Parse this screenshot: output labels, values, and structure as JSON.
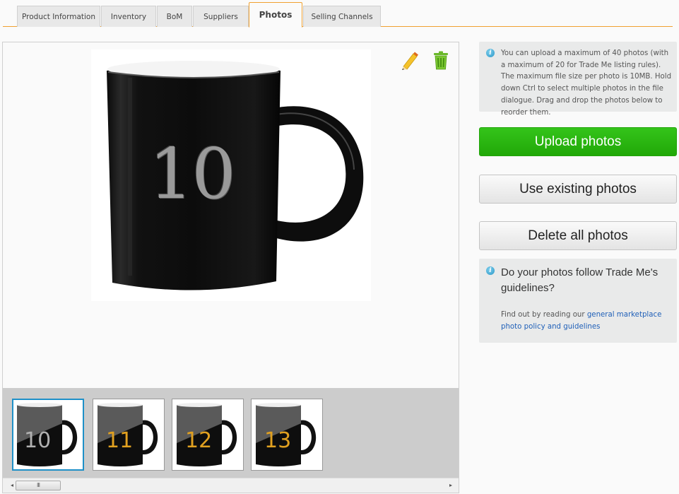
{
  "tabs": [
    {
      "label": "Product Information",
      "active": false
    },
    {
      "label": "Inventory",
      "active": false
    },
    {
      "label": "BoM",
      "active": false
    },
    {
      "label": "Suppliers",
      "active": false
    },
    {
      "label": "Photos",
      "active": true
    },
    {
      "label": "Selling Channels",
      "active": false
    }
  ],
  "main_photo": {
    "label": "10",
    "label_color": "#9a9a9a",
    "edit_icon": "pencil-icon",
    "delete_icon": "trash-icon"
  },
  "thumbnails": [
    {
      "label": "10",
      "label_color": "#b0b0b0",
      "selected": true
    },
    {
      "label": "11",
      "label_color": "#e0a020",
      "selected": false
    },
    {
      "label": "12",
      "label_color": "#e0a020",
      "selected": false
    },
    {
      "label": "13",
      "label_color": "#e0a020",
      "selected": false
    }
  ],
  "scrollbar": {
    "left_arrow": "◂",
    "right_arrow": "▸",
    "grip": "III"
  },
  "upload_info": {
    "icon": "info-icon",
    "text": "You can upload a maximum of 40 photos (with a maximum of 20 for Trade Me listing rules). The maximum file size per photo is 10MB. Hold down Ctrl to select multiple photos in the file dialogue. Drag and drop the photos below to reorder them."
  },
  "buttons": {
    "upload": "Upload photos",
    "use_existing": "Use existing photos",
    "delete_all": "Delete all photos"
  },
  "guidelines": {
    "icon": "info-icon",
    "title": "Do your photos follow Trade Me's guidelines?",
    "text_prefix": "Find out by reading our ",
    "link_text": "general marketplace photo policy and guidelines"
  },
  "colors": {
    "accent_orange": "#f0a030",
    "upload_green": "#2bb812",
    "selected_blue": "#1e90c8",
    "link_blue": "#2060b8"
  }
}
